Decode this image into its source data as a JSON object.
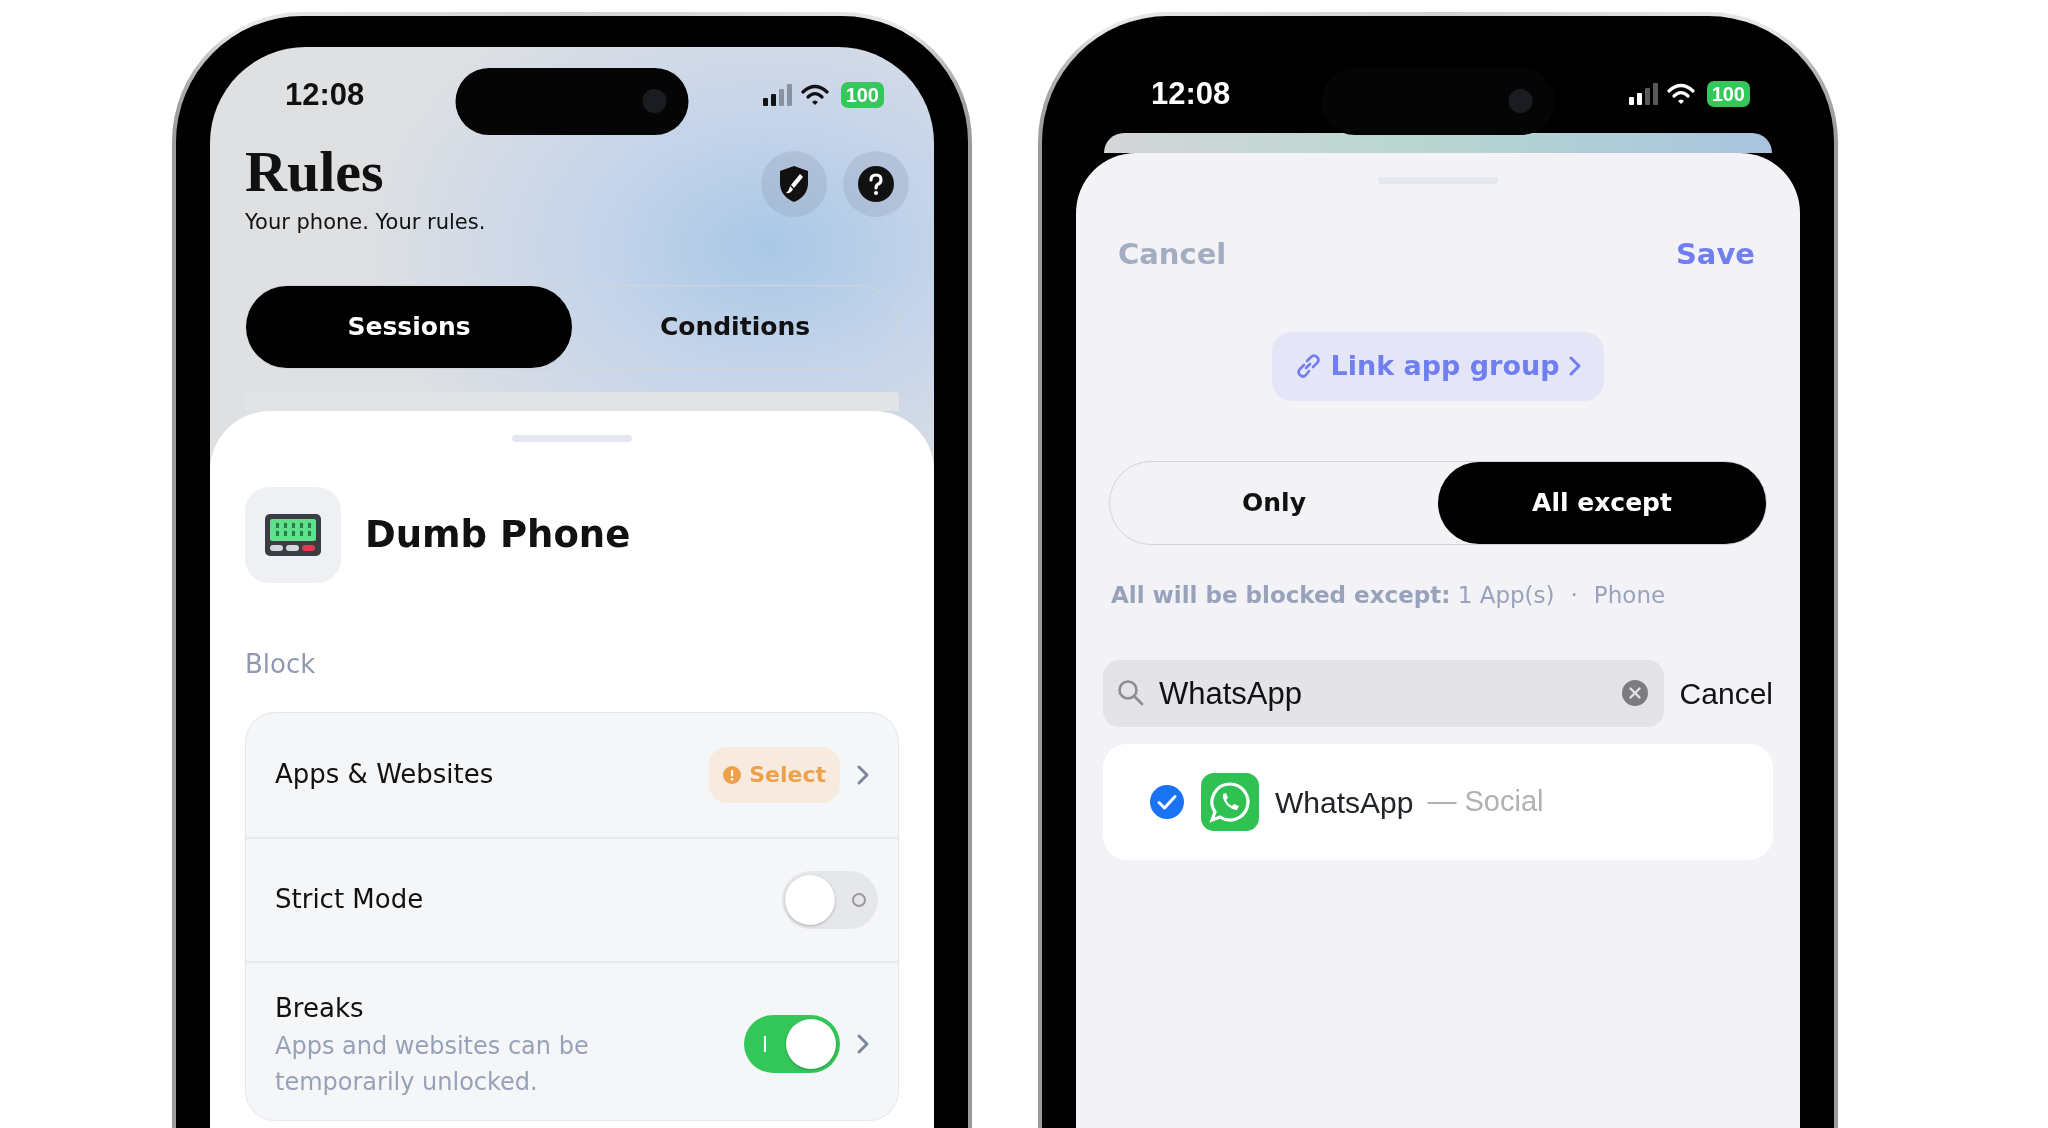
{
  "rules_screen": {
    "status_bar": {
      "time": "12:08",
      "battery": "100"
    },
    "title": "Rules",
    "subtitle": "Your phone. Your rules.",
    "tabs": [
      {
        "label": "Sessions",
        "selected": true
      },
      {
        "label": "Conditions",
        "selected": false
      }
    ],
    "profile": {
      "name": "Dumb Phone"
    },
    "section_label": "Block",
    "rows": [
      {
        "kind": "select",
        "label": "Apps & Websites",
        "badge": "Select",
        "chevron": true
      },
      {
        "kind": "toggle",
        "label": "Strict Mode",
        "on": false,
        "chevron": false
      },
      {
        "kind": "toggle",
        "label": "Breaks",
        "description": "Apps and websites can be temporarily unlocked.",
        "on": true,
        "chevron": true
      }
    ]
  },
  "app_picker_screen": {
    "status_bar": {
      "time": "12:08",
      "battery": "100"
    },
    "cancel": "Cancel",
    "save": "Save",
    "link_button": "Link app group",
    "tabs": [
      {
        "label": "Only",
        "selected": false
      },
      {
        "label": "All except",
        "selected": true
      }
    ],
    "summary": "**All will be blocked except:** 1 App(s)",
    "separator": "·",
    "summary_category": "Phone",
    "search": {
      "value": "WhatsApp"
    },
    "search_cancel": "Cancel",
    "results": [
      {
        "name": "WhatsApp",
        "category": "— Social",
        "checked": true
      }
    ]
  }
}
